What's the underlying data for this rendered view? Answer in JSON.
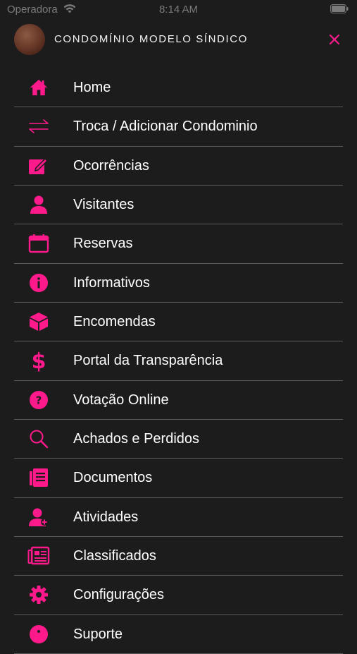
{
  "status_bar": {
    "carrier": "Operadora",
    "time": "8:14 AM"
  },
  "header": {
    "condo_name": "CONDOMÍNIO MODELO SÍNDICO"
  },
  "colors": {
    "accent": "#ff1a8c",
    "background": "#1c1c1d",
    "divider": "#5a5a5a"
  },
  "menu": {
    "items": [
      {
        "label": "Home",
        "icon": "home-icon"
      },
      {
        "label": "Troca / Adicionar Condominio",
        "icon": "swap-arrows-icon"
      },
      {
        "label": "Ocorrências",
        "icon": "edit-note-icon"
      },
      {
        "label": "Visitantes",
        "icon": "person-icon"
      },
      {
        "label": "Reservas",
        "icon": "calendar-icon"
      },
      {
        "label": "Informativos",
        "icon": "info-icon"
      },
      {
        "label": "Encomendas",
        "icon": "package-box-icon"
      },
      {
        "label": "Portal da Transparência",
        "icon": "dollar-sign-icon"
      },
      {
        "label": "Votação Online",
        "icon": "question-circle-icon"
      },
      {
        "label": "Achados e Perdidos",
        "icon": "search-icon"
      },
      {
        "label": "Documentos",
        "icon": "document-icon"
      },
      {
        "label": "Atividades",
        "icon": "person-add-icon"
      },
      {
        "label": "Classificados",
        "icon": "newspaper-icon"
      },
      {
        "label": "Configurações",
        "icon": "gear-icon"
      },
      {
        "label": "Suporte",
        "icon": "support-icon"
      }
    ]
  }
}
